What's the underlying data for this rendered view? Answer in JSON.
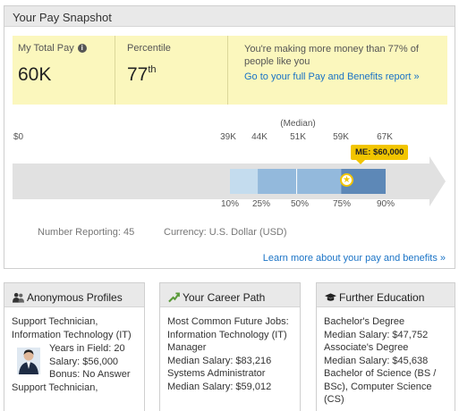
{
  "snapshot": {
    "title": "Your Pay Snapshot",
    "total_pay_label": "My Total Pay",
    "total_pay_value": "60K",
    "percentile_label": "Percentile",
    "percentile_value": "77",
    "percentile_suffix": "th",
    "message": "You're making more money than 77% of people like you",
    "report_link": "Go to your full Pay and Benefits report »",
    "chart": {
      "zero_label": "$0",
      "median_label": "(Median)",
      "salary_ticks": [
        "39K",
        "44K",
        "51K",
        "59K",
        "67K"
      ],
      "percentile_ticks": [
        "10%",
        "25%",
        "50%",
        "75%",
        "90%"
      ],
      "me_label": "ME: $60,000",
      "colors": {
        "p10_25": "#c4dcee",
        "p25_75": "#93b9dc",
        "p75_90": "#5d88b7",
        "arrow": "#e1e1e1",
        "badge": "#f2c500"
      }
    },
    "number_reporting": "Number Reporting: 45",
    "currency": "Currency: U.S. Dollar (USD)",
    "learn_more": "Learn more about your pay and benefits »"
  },
  "chart_data": {
    "type": "bar",
    "title": "",
    "categories": [
      "10%",
      "25%",
      "50%",
      "75%",
      "90%"
    ],
    "values": [
      39000,
      44000,
      51000,
      59000,
      67000
    ],
    "marker": {
      "label": "ME: $60,000",
      "value": 60000
    },
    "x_min_label": "$0"
  },
  "profiles": {
    "title": "Anonymous Profiles",
    "job1": "Support Technician, Information Technology (IT)",
    "years": "Years in Field: 20",
    "salary": "Salary: $56,000",
    "bonus": "Bonus: No Answer",
    "job2": "Support Technician,"
  },
  "career": {
    "title": "Your Career Path",
    "heading": "Most Common Future Jobs:",
    "job1": "Information Technology (IT) Manager",
    "salary1": "Median Salary: $83,216",
    "job2": "Systems Administrator",
    "salary2": "Median Salary: $59,012"
  },
  "education": {
    "title": "Further Education",
    "deg1": "Bachelor's Degree",
    "sal1": "Median Salary: $47,752",
    "deg2": "Associate's Degree",
    "sal2": "Median Salary: $45,638",
    "deg3": "Bachelor of Science (BS / BSc), Computer Science (CS)"
  }
}
